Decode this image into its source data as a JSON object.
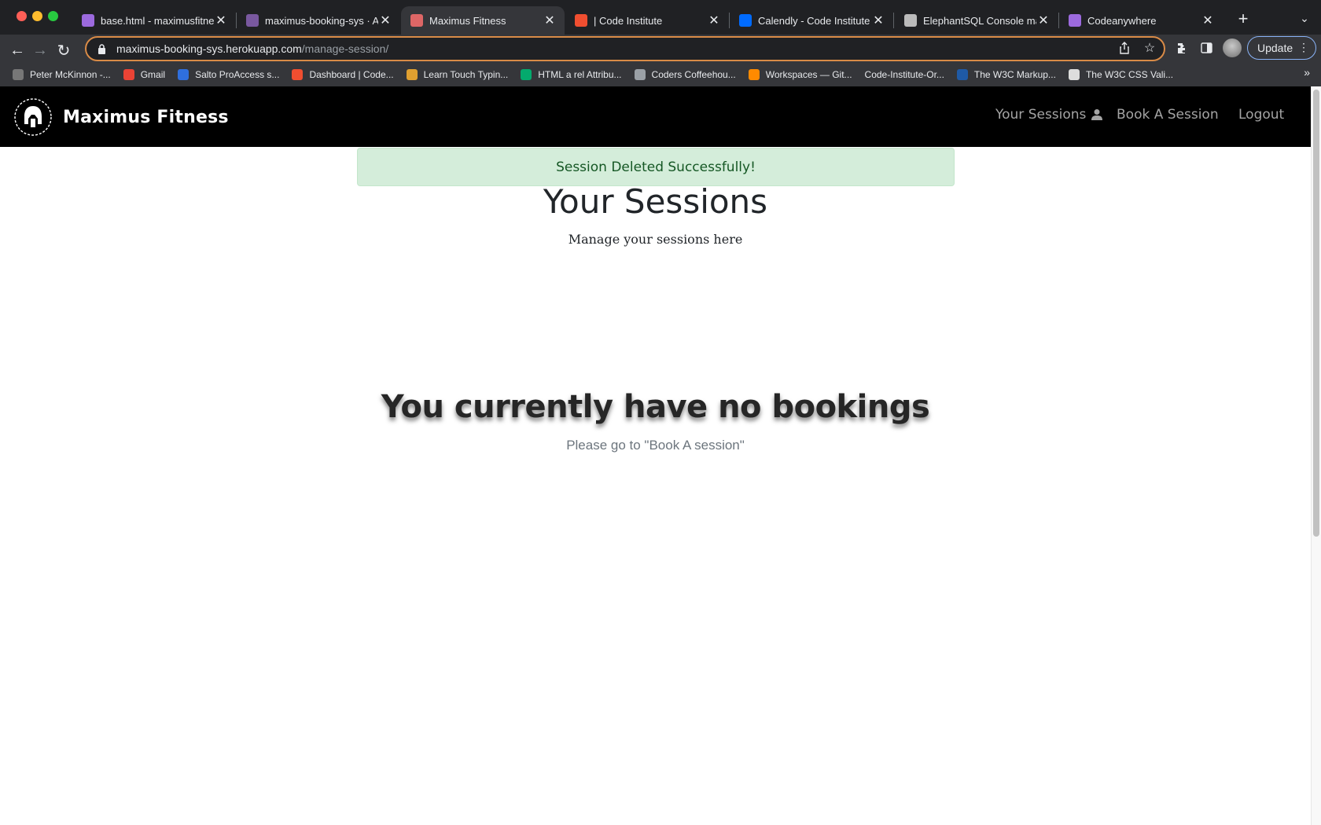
{
  "browser": {
    "tabs": [
      {
        "title": "base.html - maximusfitness",
        "favicon": "purple-cube-icon",
        "color": "#9c6ade",
        "active": false
      },
      {
        "title": "maximus-booking-sys · A",
        "favicon": "heroku-icon",
        "color": "#79589f",
        "active": false
      },
      {
        "title": "Maximus Fitness",
        "favicon": "maximus-icon",
        "color": "#d66",
        "active": true
      },
      {
        "title": "| Code Institute",
        "favicon": "code-institute-icon",
        "color": "#f04e30",
        "active": false
      },
      {
        "title": "Calendly - Code Institute",
        "favicon": "calendly-icon",
        "color": "#006bff",
        "active": false
      },
      {
        "title": "ElephantSQL Console ma",
        "favicon": "elephant-icon",
        "color": "#bbb",
        "active": false
      },
      {
        "title": "Codeanywhere",
        "favicon": "purple-cube-icon",
        "color": "#9c6ade",
        "active": false
      }
    ],
    "close_glyph": "✕",
    "new_tab_glyph": "+",
    "url_host": "maximus-booking-sys.herokuapp.com",
    "url_path": "/manage-session/",
    "update_label": "Update",
    "bookmarks": [
      {
        "label": "Peter McKinnon -...",
        "icon": "bookmark-icon",
        "color": "#777"
      },
      {
        "label": "Gmail",
        "icon": "gmail-icon",
        "color": "#ea4335"
      },
      {
        "label": "Salto ProAccess s...",
        "icon": "salto-icon",
        "color": "#2f6fde"
      },
      {
        "label": "Dashboard | Code...",
        "icon": "code-institute-icon",
        "color": "#f04e30"
      },
      {
        "label": "Learn Touch Typin...",
        "icon": "typing-icon",
        "color": "#e0a030"
      },
      {
        "label": "HTML a rel Attribu...",
        "icon": "w3schools-icon",
        "color": "#04aa6d"
      },
      {
        "label": "Coders Coffeehou...",
        "icon": "globe-icon",
        "color": "#9aa0a6"
      },
      {
        "label": "Workspaces — Git...",
        "icon": "gitpod-icon",
        "color": "#ff8a00"
      },
      {
        "label": "Code-Institute-Or...",
        "icon": "none",
        "color": "transparent"
      },
      {
        "label": "The W3C Markup...",
        "icon": "w3c-icon",
        "color": "#1f5aa6"
      },
      {
        "label": "The W3C CSS Vali...",
        "icon": "w3c-css-icon",
        "color": "#ddd"
      }
    ],
    "bookmarks_more": "»"
  },
  "site": {
    "brand_name": "Maximus Fitness",
    "nav": {
      "your_sessions": "Your Sessions",
      "book_session": "Book A Session",
      "logout": "Logout"
    },
    "alert_message": "Session Deleted Successfully!",
    "heading": "Your Sessions",
    "subheading": "Manage your sessions here",
    "empty_heading": "You currently have no bookings",
    "empty_sub": "Please go to \"Book A session\""
  }
}
